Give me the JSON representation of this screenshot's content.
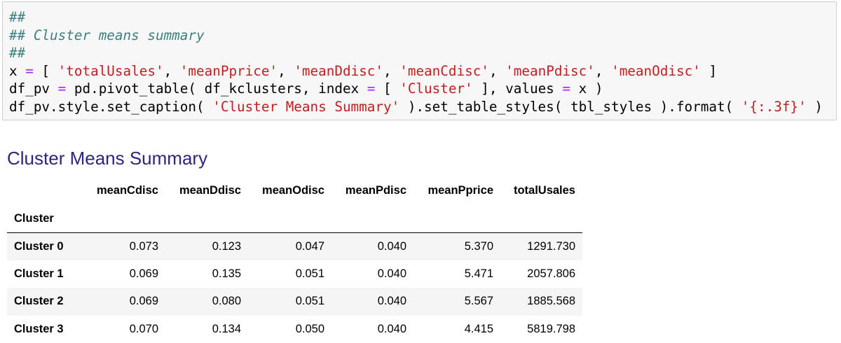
{
  "code_cell": {
    "lines": [
      [
        {
          "t": "##",
          "c": "comment"
        }
      ],
      [
        {
          "t": "## Cluster means summary",
          "c": "comment"
        }
      ],
      [
        {
          "t": "##",
          "c": "comment"
        }
      ],
      [
        {
          "t": "x ",
          "c": "plain"
        },
        {
          "t": "=",
          "c": "op"
        },
        {
          "t": " [ ",
          "c": "plain"
        },
        {
          "t": "'totalUsales'",
          "c": "str"
        },
        {
          "t": ", ",
          "c": "plain"
        },
        {
          "t": "'meanPprice'",
          "c": "str"
        },
        {
          "t": ", ",
          "c": "plain"
        },
        {
          "t": "'meanDdisc'",
          "c": "str"
        },
        {
          "t": ", ",
          "c": "plain"
        },
        {
          "t": "'meanCdisc'",
          "c": "str"
        },
        {
          "t": ", ",
          "c": "plain"
        },
        {
          "t": "'meanPdisc'",
          "c": "str"
        },
        {
          "t": ", ",
          "c": "plain"
        },
        {
          "t": "'meanOdisc'",
          "c": "str"
        },
        {
          "t": " ]",
          "c": "plain"
        }
      ],
      [
        {
          "t": "df_pv ",
          "c": "plain"
        },
        {
          "t": "=",
          "c": "op"
        },
        {
          "t": " pd.pivot_table( df_kclusters, index ",
          "c": "plain"
        },
        {
          "t": "=",
          "c": "op"
        },
        {
          "t": " [ ",
          "c": "plain"
        },
        {
          "t": "'Cluster'",
          "c": "str"
        },
        {
          "t": " ], values ",
          "c": "plain"
        },
        {
          "t": "=",
          "c": "op"
        },
        {
          "t": " x )",
          "c": "plain"
        }
      ],
      [
        {
          "t": "df_pv.style.set_caption( ",
          "c": "plain"
        },
        {
          "t": "'Cluster Means Summary'",
          "c": "str"
        },
        {
          "t": " ).set_table_styles( tbl_styles ).format( ",
          "c": "plain"
        },
        {
          "t": "'{:.3f}'",
          "c": "str"
        },
        {
          "t": " )",
          "c": "plain"
        }
      ]
    ]
  },
  "output": {
    "caption": "Cluster Means Summary",
    "index_name": "Cluster",
    "columns": [
      "meanCdisc",
      "meanDdisc",
      "meanOdisc",
      "meanPdisc",
      "meanPprice",
      "totalUsales"
    ],
    "rows": [
      {
        "label": "Cluster 0",
        "values": [
          "0.073",
          "0.123",
          "0.047",
          "0.040",
          "5.370",
          "1291.730"
        ]
      },
      {
        "label": "Cluster 1",
        "values": [
          "0.069",
          "0.135",
          "0.051",
          "0.040",
          "5.471",
          "2057.806"
        ]
      },
      {
        "label": "Cluster 2",
        "values": [
          "0.069",
          "0.080",
          "0.051",
          "0.040",
          "5.567",
          "1885.568"
        ]
      },
      {
        "label": "Cluster 3",
        "values": [
          "0.070",
          "0.134",
          "0.050",
          "0.040",
          "4.415",
          "5819.798"
        ]
      }
    ]
  }
}
